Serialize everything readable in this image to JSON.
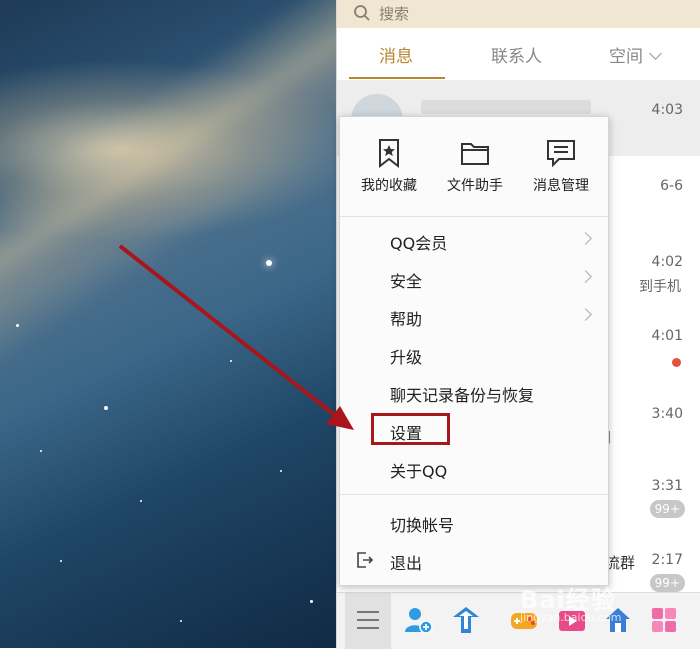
{
  "search": {
    "placeholder": "搜索"
  },
  "tabs": [
    {
      "label": "消息",
      "active": true
    },
    {
      "label": "联系人",
      "active": false
    },
    {
      "label": "空间",
      "active": false
    }
  ],
  "chats": [
    {
      "time": "4:03",
      "snippet": "",
      "name_tail": "",
      "badge": "",
      "unread_dot": false,
      "selected": true
    },
    {
      "time": "6-6",
      "snippet": "",
      "name_tail": "",
      "badge": "",
      "unread_dot": false,
      "selected": false
    },
    {
      "time": "4:02",
      "snippet": "到手机",
      "name_tail": "",
      "badge": "",
      "unread_dot": false,
      "selected": false
    },
    {
      "time": "4:01",
      "snippet": "",
      "name_tail": "",
      "badge": "",
      "unread_dot": true,
      "selected": false
    },
    {
      "time": "3:40",
      "snippet": "]",
      "name_tail": "",
      "badge": "",
      "unread_dot": false,
      "selected": false
    },
    {
      "time": "3:31",
      "snippet": "",
      "name_tail": "",
      "badge": "99+",
      "unread_dot": false,
      "selected": false
    },
    {
      "time": "2:17",
      "snippet": "",
      "name_tail": "流群",
      "badge": "99+",
      "unread_dot": false,
      "selected": false
    }
  ],
  "popup": {
    "quick_actions": [
      {
        "label": "我的收藏",
        "icon": "bookmark-star-icon"
      },
      {
        "label": "文件助手",
        "icon": "folder-icon"
      },
      {
        "label": "消息管理",
        "icon": "message-manage-icon"
      }
    ],
    "items": [
      {
        "label": "QQ会员",
        "has_submenu": true
      },
      {
        "label": "安全",
        "has_submenu": true
      },
      {
        "label": "帮助",
        "has_submenu": true
      },
      {
        "label": "升级",
        "has_submenu": false
      },
      {
        "label": "聊天记录备份与恢复",
        "has_submenu": false
      },
      {
        "label": "设置",
        "has_submenu": false,
        "highlighted": true
      },
      {
        "label": "关于QQ",
        "has_submenu": false
      }
    ],
    "account_items": [
      {
        "label": "切换帐号"
      },
      {
        "label": "退出",
        "icon": "exit-icon"
      }
    ]
  },
  "annotation": {
    "color": "#a8151b"
  },
  "theme": {
    "accent": "#b8862d",
    "search_bg": "#f1e6d1"
  }
}
